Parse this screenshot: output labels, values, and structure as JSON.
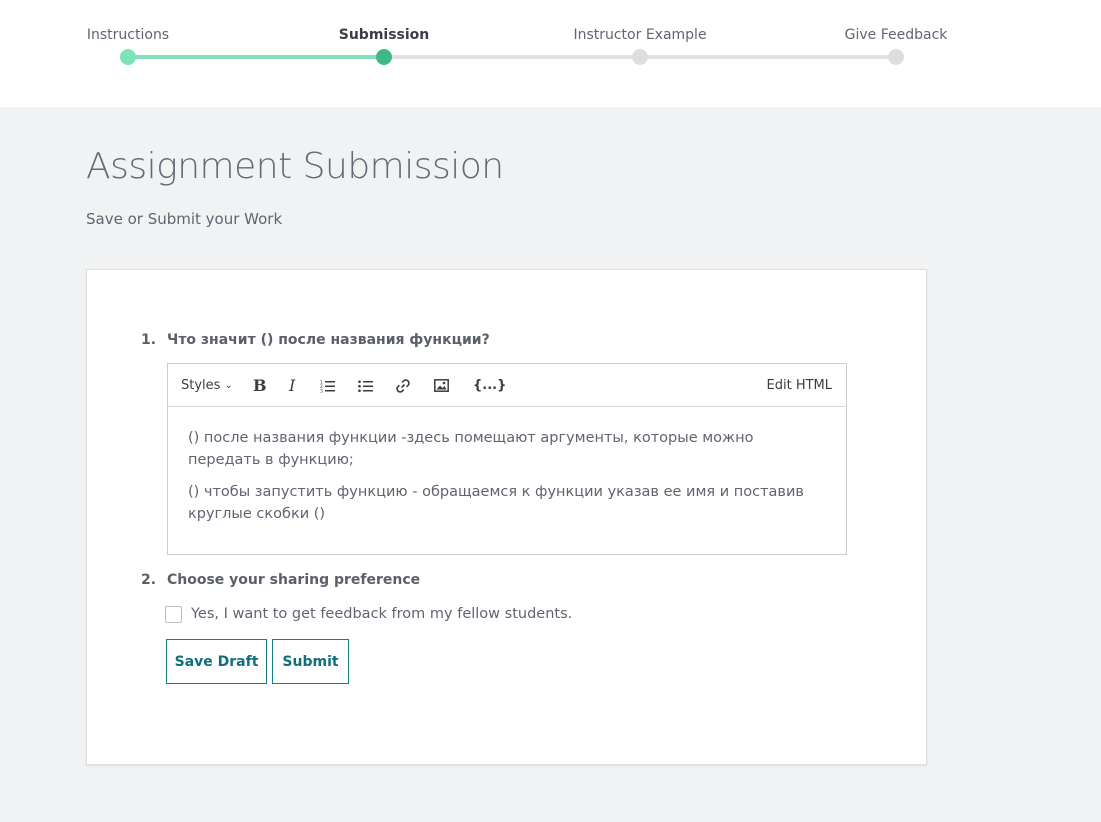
{
  "stepper": {
    "steps": [
      {
        "label": "Instructions",
        "state": "done"
      },
      {
        "label": "Submission",
        "state": "current"
      },
      {
        "label": "Instructor Example",
        "state": "todo"
      },
      {
        "label": "Give Feedback",
        "state": "todo"
      }
    ]
  },
  "header": {
    "title": "Assignment Submission",
    "subtitle": "Save or Submit your Work"
  },
  "form": {
    "question1": {
      "number": "1.",
      "text": "Что значит () после названия функции?"
    },
    "editor": {
      "toolbar": {
        "styles_label": "Styles",
        "bold_label": "B",
        "italic_label": "I",
        "code_label": "{...}",
        "edit_html_label": "Edit HTML",
        "icons": [
          "ordered-list-icon",
          "bullet-list-icon",
          "link-icon",
          "image-icon"
        ]
      },
      "paragraphs": [
        "() после названия функции -здесь помещают аргументы, которые можно передать в функцию;",
        "() чтобы запустить функцию - обращаемся к функции указав ее имя и поставив круглые скобки ()"
      ]
    },
    "question2": {
      "number": "2.",
      "text": "Choose your sharing preference"
    },
    "sharing_checkbox": {
      "label": "Yes, I want to get feedback from my fellow students.",
      "checked": false
    },
    "buttons": {
      "save_draft": "Save Draft",
      "submit": "Submit"
    }
  },
  "colors": {
    "progress_done": "#7fe1b8",
    "progress_current": "#3fb888",
    "button_accent": "#0f6f7b"
  }
}
